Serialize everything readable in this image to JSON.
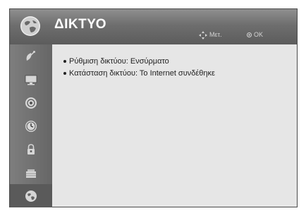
{
  "header": {
    "title": "ΔΙΚΤΥΟ",
    "hint_move": "Μετ.",
    "hint_ok": "OK",
    "icon": "network-globe-icon"
  },
  "sidebar": {
    "items": [
      {
        "icon": "satellite-dish-icon",
        "active": false
      },
      {
        "icon": "picture-monitor-icon",
        "active": false
      },
      {
        "icon": "audio-speaker-icon",
        "active": false
      },
      {
        "icon": "clock-icon",
        "active": false
      },
      {
        "icon": "lock-icon",
        "active": false
      },
      {
        "icon": "options-icon",
        "active": false
      },
      {
        "icon": "network-globe-icon",
        "active": true
      }
    ]
  },
  "content": {
    "items": [
      "Ρύθμιση δικτύου: Ενσύρματο",
      "Κατάσταση δικτύου: Το Internet συνδέθηκε"
    ]
  },
  "colors": {
    "header_bg": "#6e6e6e",
    "sidebar_bg": "#737373",
    "content_bg": "#e6e6e6"
  }
}
